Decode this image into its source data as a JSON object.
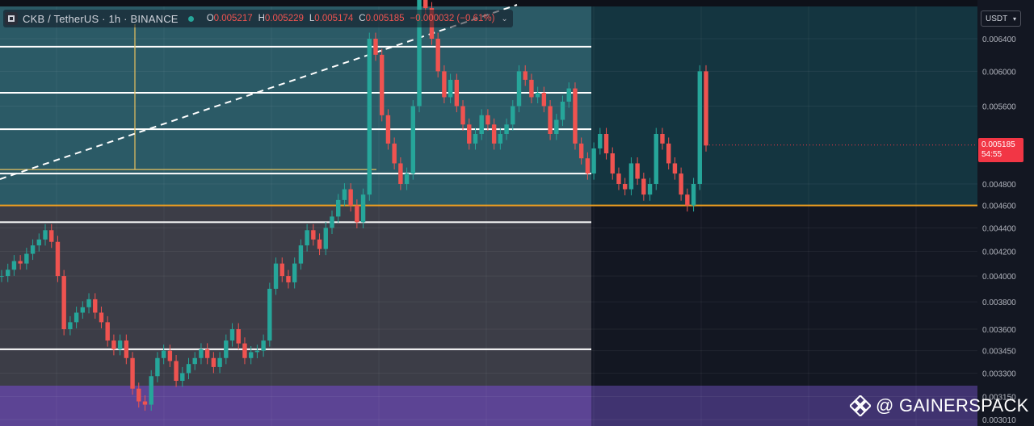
{
  "header": {
    "title": "CKB / TetherUS · 1h · BINANCE",
    "ohlc": {
      "o_label": "O",
      "o": "0.005217",
      "h_label": "H",
      "h": "0.005229",
      "l_label": "L",
      "l": "0.005174",
      "c_label": "C",
      "c": "0.005185",
      "change": "−0.000032 (−0.61%)"
    }
  },
  "price_axis": {
    "currency": "USDT",
    "ticks": [
      "0.006400",
      "0.006000",
      "0.005600",
      "0.004800",
      "0.004600",
      "0.004400",
      "0.004200",
      "0.004000",
      "0.003800",
      "0.003600",
      "0.003450",
      "0.003300",
      "0.003150",
      "0.003010"
    ],
    "current_price": "0.005185",
    "countdown": "54:55"
  },
  "watermark": "@ GAINERSPACK",
  "colors": {
    "background": "#131722",
    "upper_zone": "#2b5a66",
    "lower_zone": "#3c3d47",
    "bottom_zone": "#5c4494",
    "support_line": "#f0a020",
    "level_line": "#ffffff",
    "candle_up": "#26a69a",
    "candle_down": "#ef5350"
  },
  "chart_data": {
    "type": "line",
    "title": "CKB / TetherUS · 1h · BINANCE",
    "y_scale": "log",
    "ylim": [
      0.00301,
      0.0069
    ],
    "grid": true,
    "series": [
      {
        "values": [
          0.004,
          0.00405,
          0.00412,
          0.0041,
          0.00418,
          0.00425,
          0.0043,
          0.00438,
          0.00428,
          0.004,
          0.0036,
          0.00365,
          0.00372,
          0.00376,
          0.00382,
          0.00372,
          0.00365,
          0.00352,
          0.00346,
          0.00352,
          0.0034,
          0.0032,
          0.00312,
          0.0031,
          0.00328,
          0.0034,
          0.00345,
          0.00338,
          0.00325,
          0.0033,
          0.00336,
          0.0034,
          0.00346,
          0.0034,
          0.00334,
          0.0034,
          0.00352,
          0.0036,
          0.0035,
          0.0034,
          0.00344,
          0.00345,
          0.00352,
          0.0039,
          0.0041,
          0.004,
          0.00395,
          0.0041,
          0.00425,
          0.00438,
          0.0043,
          0.00422,
          0.0044,
          0.0045,
          0.00465,
          0.00475,
          0.0046,
          0.00445,
          0.0047,
          0.0064,
          0.0062,
          0.0055,
          0.0052,
          0.005,
          0.0048,
          0.0049,
          0.0056,
          0.007,
          0.0068,
          0.0064,
          0.006,
          0.0057,
          0.0059,
          0.0056,
          0.0054,
          0.0052,
          0.0053,
          0.0055,
          0.0054,
          0.0052,
          0.0053,
          0.0054,
          0.0056,
          0.006,
          0.0059,
          0.0057,
          0.00575,
          0.0056,
          0.0053,
          0.00545,
          0.00565,
          0.0058,
          0.0052,
          0.00505,
          0.0049,
          0.00515,
          0.0053,
          0.0051,
          0.0049,
          0.0048,
          0.00475,
          0.005,
          0.00485,
          0.0047,
          0.0048,
          0.0053,
          0.0052,
          0.005,
          0.0049,
          0.0047,
          0.0046,
          0.0048,
          0.006,
          0.00518
        ]
      }
    ],
    "levels": [
      0.0063,
      0.00575,
      0.00535,
      0.0049,
      0.00445,
      0.00346
    ],
    "support_level": 0.0046,
    "annotations": []
  }
}
